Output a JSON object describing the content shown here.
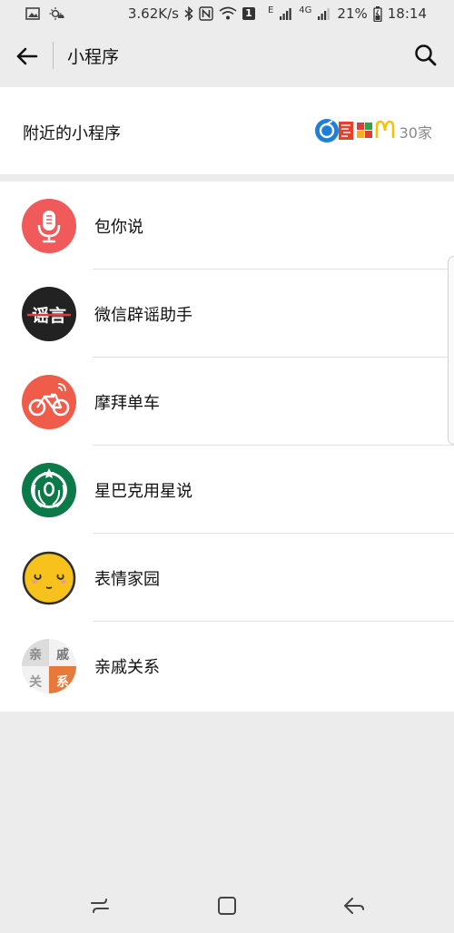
{
  "status_bar": {
    "speed": "3.62K/s",
    "network_badge": "1",
    "network_type": "E",
    "lte": "4G",
    "battery": "21%",
    "time": "18:14"
  },
  "header": {
    "title": "小程序",
    "back_icon": "arrow-left-icon",
    "search_icon": "search-icon"
  },
  "nearby": {
    "label": "附近的小程序",
    "count": "30家"
  },
  "apps": [
    {
      "name": "包你说",
      "icon": "microphone-icon",
      "color": "#f05a5a"
    },
    {
      "name": "微信辟谣助手",
      "icon": "rumor-text-icon",
      "color": "#222222"
    },
    {
      "name": "摩拜单车",
      "icon": "bicycle-icon",
      "color": "#ef5c4a"
    },
    {
      "name": "星巴克用星说",
      "icon": "starbucks-siren-icon",
      "color": "#0b7a48"
    },
    {
      "name": "表情家园",
      "icon": "smiley-face-icon",
      "color": "#f7c21c"
    },
    {
      "name": "亲戚关系",
      "icon": "relatives-grid-icon",
      "color": "#e77a3a"
    }
  ],
  "rumor_icon_text": "谣言",
  "relatives_icon_chars": [
    "亲",
    "戚",
    "关",
    "系"
  ],
  "colors": {
    "background": "#ececec",
    "card": "#ffffff",
    "divider": "#e2e2e2",
    "secondary_text": "#8a8a8a"
  }
}
